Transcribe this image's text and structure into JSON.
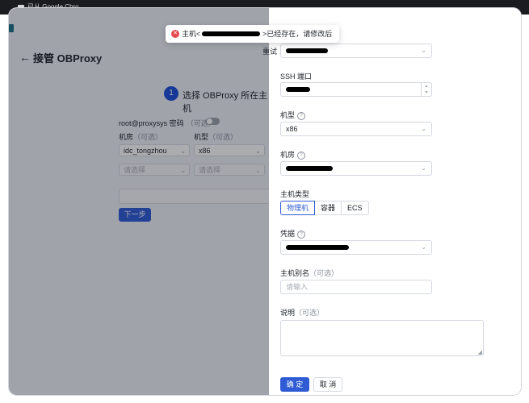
{
  "browser": {
    "tab_title": "已从 Google Chro..."
  },
  "page": {
    "back_icon": "arrow-left-icon",
    "title": "接管 OBProxy",
    "step": {
      "number": "1",
      "label": "选择 OBProxy 所在主机"
    },
    "password_label": "root@proxysys 密码",
    "password_optional": "（可选）",
    "password_toggle_on": false,
    "idc_label": "机房",
    "idc_optional": "（可选）",
    "type_label": "机型",
    "type_optional": "（可选）",
    "row1": {
      "idc": "idc_tongzhou",
      "type": "x86"
    },
    "row2": {
      "idc_placeholder": "请选择",
      "type_placeholder": "请选择"
    },
    "next_button": "下一步"
  },
  "drawer": {
    "ssh_port_label": "SSH 端口",
    "model_label": "机型",
    "model_value": "x86",
    "idc_label": "机房",
    "host_type_label": "主机类型",
    "host_types": [
      "物理机",
      "容器",
      "ECS"
    ],
    "host_type_selected": "物理机",
    "credential_label": "凭据",
    "alias_label": "主机别名",
    "alias_optional": "（可选）",
    "alias_placeholder": "请输入",
    "desc_label": "说明",
    "desc_optional": "（可选）",
    "ok_button": "确 定",
    "cancel_button": "取 消"
  },
  "toast": {
    "prefix": "主机<",
    "suffix": ">已经存在，请修改后重试",
    "icon": "error-icon",
    "color": "#e5484d"
  },
  "colors": {
    "primary": "#2f5bd5",
    "overlay": "rgba(15,18,30,0.35)"
  }
}
